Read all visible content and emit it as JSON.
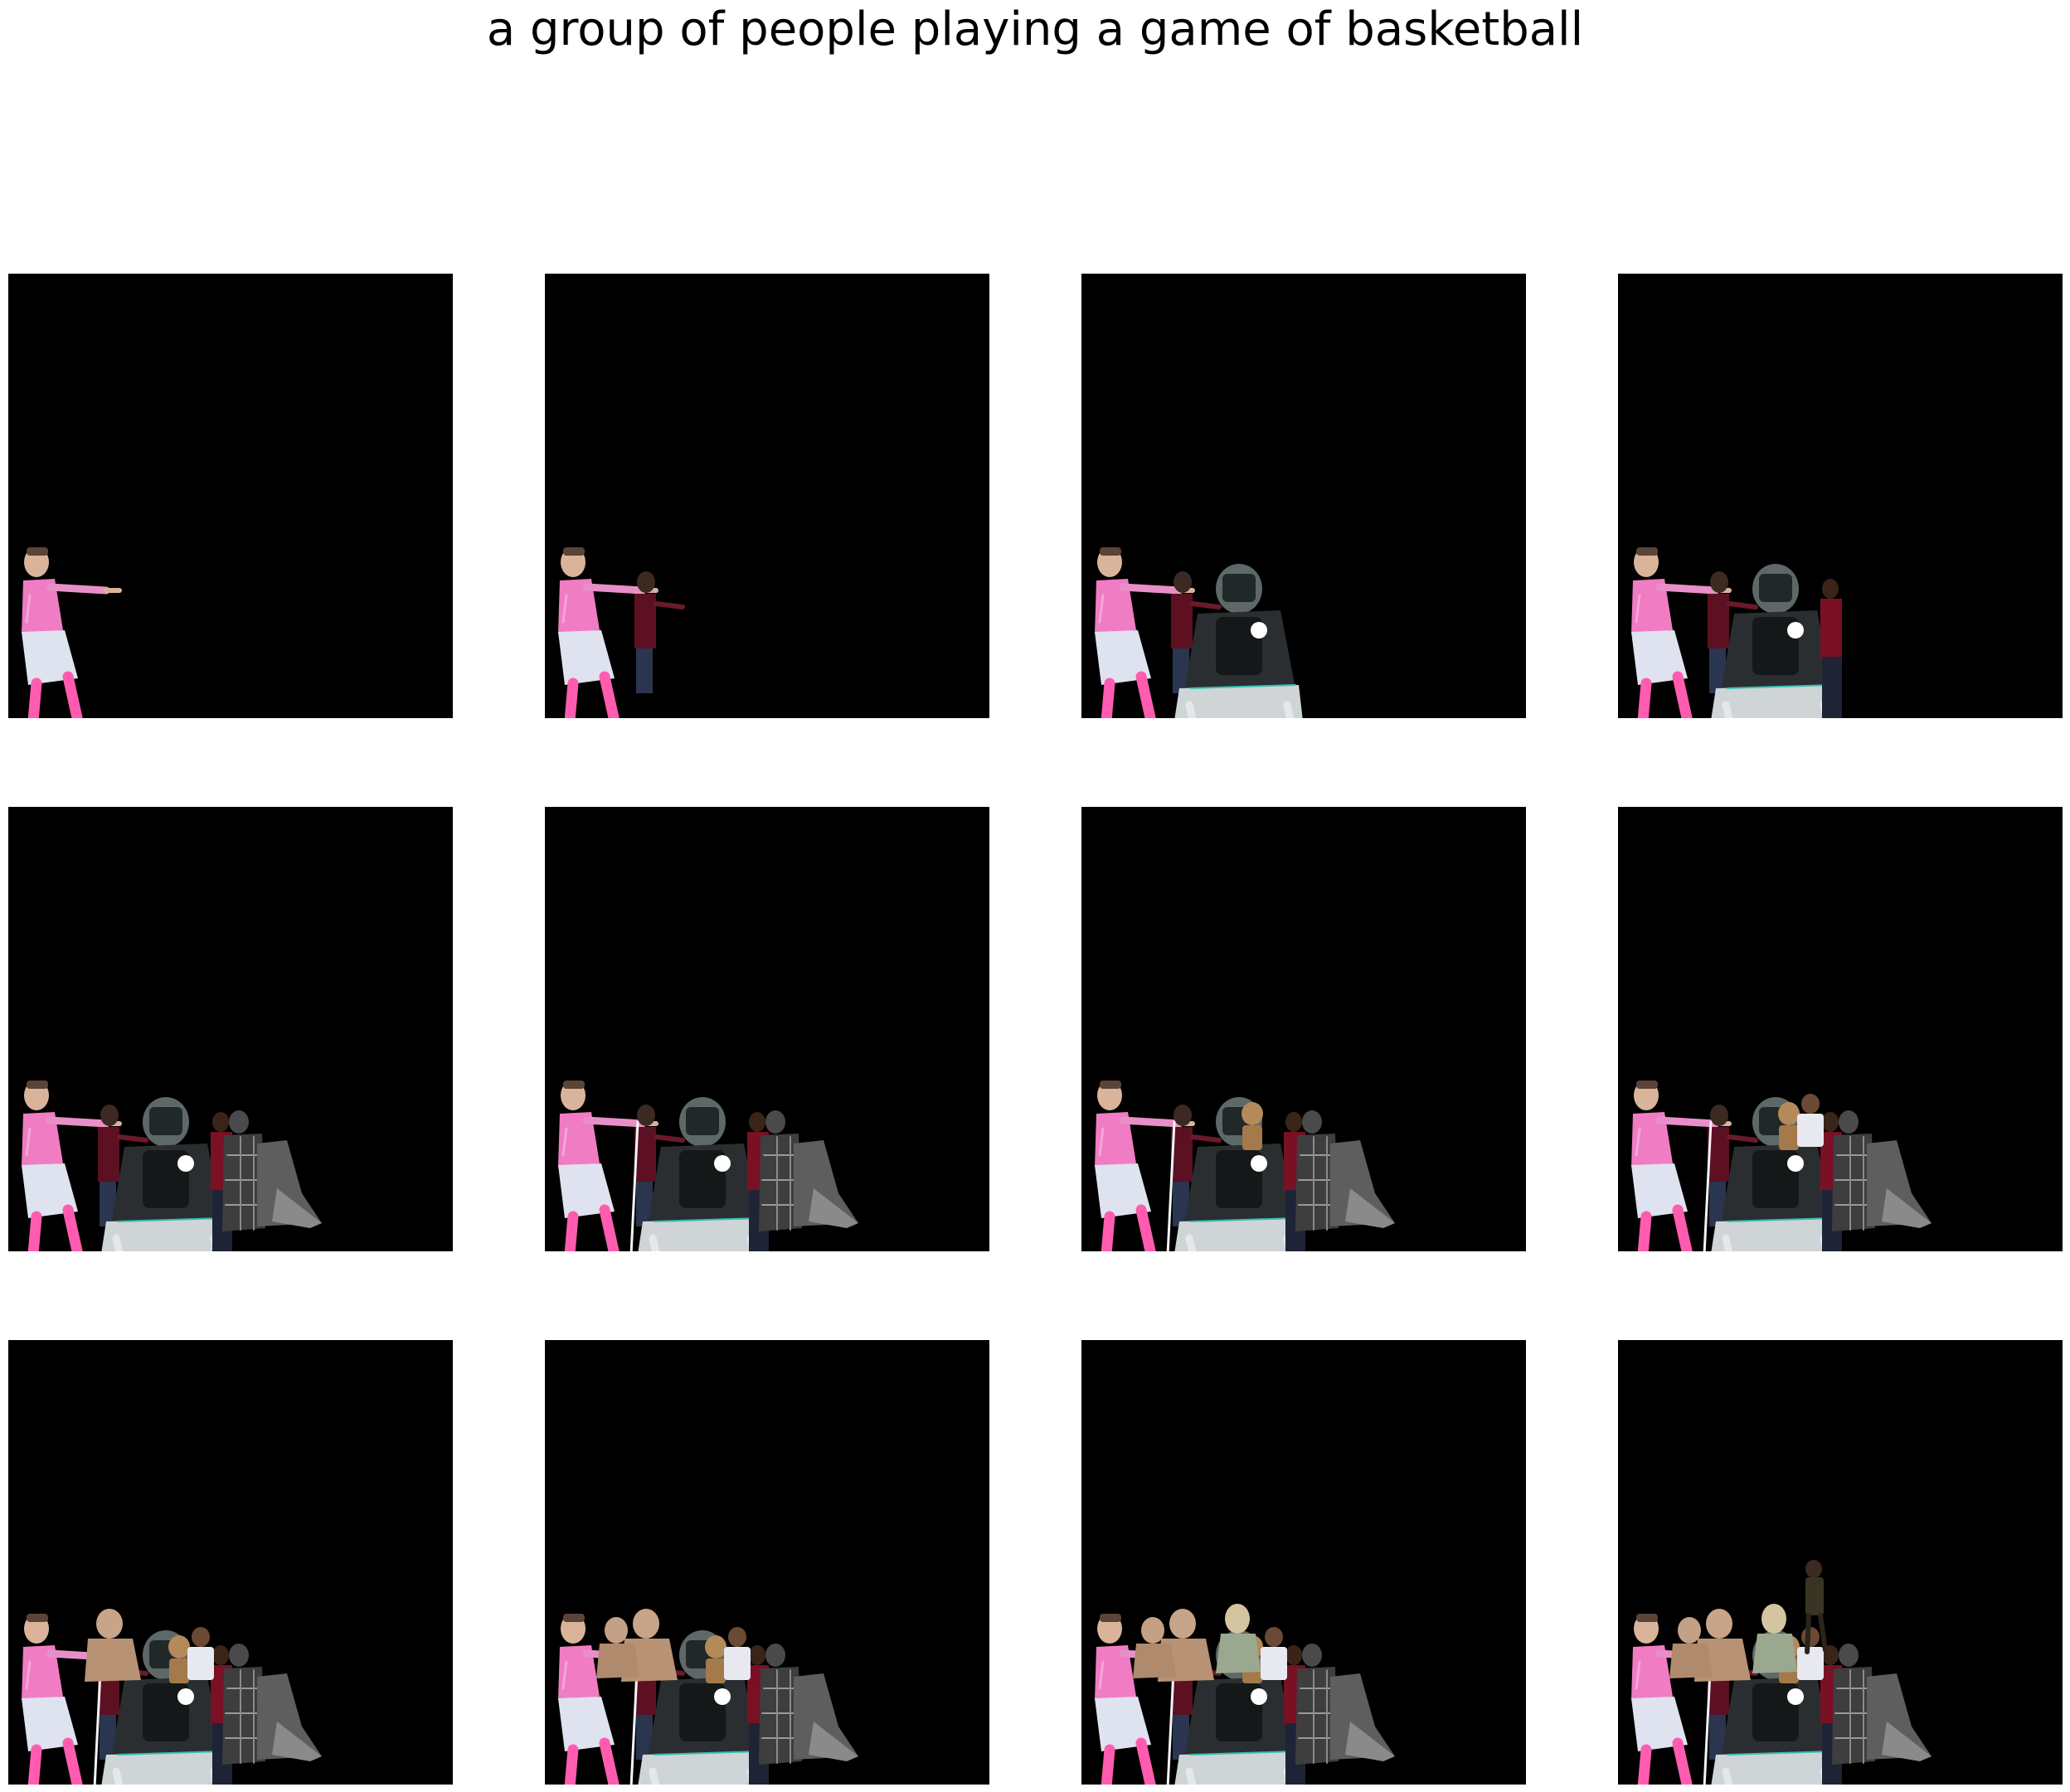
{
  "title": "a group of people playing a game of basketball",
  "colors": {
    "background": "#ffffff",
    "panel_fill": "#000000"
  },
  "grid": {
    "rows": 3,
    "columns": 4
  },
  "panels": [
    {
      "figures": [
        "pink-player"
      ]
    },
    {
      "figures": [
        "pink-player",
        "kid-in-red"
      ]
    },
    {
      "figures": [
        "pink-player",
        "kid-in-red",
        "catcher"
      ]
    },
    {
      "figures": [
        "pink-player",
        "kid-in-red",
        "catcher",
        "man-in-red"
      ]
    },
    {
      "figures": [
        "pink-player",
        "kid-in-red",
        "catcher",
        "man-in-red",
        "plaid-person",
        "gray-seated-figure"
      ]
    },
    {
      "figures": [
        "pink-player",
        "kid-in-red",
        "catcher",
        "man-in-red",
        "plaid-person",
        "gray-seated-figure",
        "white-outline"
      ]
    },
    {
      "figures": [
        "pink-player",
        "kid-in-red",
        "catcher",
        "man-in-red",
        "plaid-person",
        "gray-seated-figure",
        "white-outline",
        "tan-figure"
      ]
    },
    {
      "figures": [
        "pink-player",
        "kid-in-red",
        "catcher",
        "man-in-red",
        "plaid-person",
        "gray-seated-figure",
        "white-outline",
        "tan-figure",
        "white-shirt-figure"
      ]
    },
    {
      "figures": [
        "pink-player",
        "kid-in-red",
        "catcher",
        "man-in-red",
        "plaid-person",
        "gray-seated-figure",
        "white-outline",
        "tan-figure",
        "white-shirt-figure",
        "bare-torso-figure"
      ]
    },
    {
      "figures": [
        "pink-player",
        "kid-in-red",
        "catcher",
        "man-in-red",
        "plaid-person",
        "gray-seated-figure",
        "white-outline",
        "tan-figure",
        "white-shirt-figure",
        "bare-torso-figure",
        "second-torso-figure"
      ]
    },
    {
      "figures": [
        "pink-player",
        "kid-in-red",
        "catcher",
        "man-in-red",
        "plaid-person",
        "gray-seated-figure",
        "white-outline",
        "tan-figure",
        "white-shirt-figure",
        "bare-torso-figure",
        "second-torso-figure",
        "bald-man"
      ]
    },
    {
      "figures": [
        "pink-player",
        "kid-in-red",
        "catcher",
        "man-in-red",
        "plaid-person",
        "gray-seated-figure",
        "white-outline",
        "tan-figure",
        "white-shirt-figure",
        "bare-torso-figure",
        "second-torso-figure",
        "bald-man",
        "small-dark-figure"
      ]
    }
  ]
}
